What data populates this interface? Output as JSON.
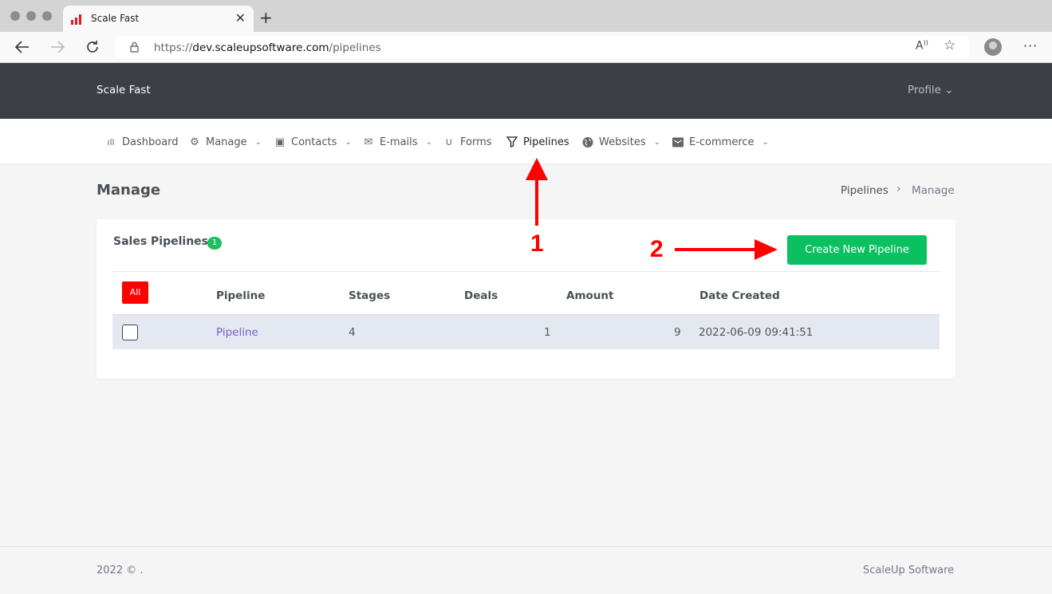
{
  "browser": {
    "tab_title": "Scale Fast",
    "tab_close": "✕",
    "new_tab": "+",
    "url_prefix": "https://",
    "url_host": "dev.scaleupsoftware.com",
    "url_path": "/pipelines",
    "brand_color": "#e8141d"
  },
  "header": {
    "brand": "Scale Fast",
    "profile_label": "Profile ⌄"
  },
  "nav": {
    "items": [
      {
        "label": "Dashboard",
        "icon": "bar-chart-icon",
        "glyph": "ıll"
      },
      {
        "label": "Manage",
        "icon": "gear-icon",
        "glyph": "⚙"
      },
      {
        "label": "Contacts",
        "icon": "contact-card-icon",
        "glyph": "▣"
      },
      {
        "label": "E-mails",
        "icon": "envelope-icon",
        "glyph": "✉"
      },
      {
        "label": "Forms",
        "icon": "magnet-icon",
        "glyph": "∪"
      },
      {
        "label": "Pipelines",
        "icon": "filter-icon",
        "glyph": "⏷"
      },
      {
        "label": "Websites",
        "icon": "globe-icon",
        "glyph": "●"
      },
      {
        "label": "E-commerce",
        "icon": "store-icon",
        "glyph": "▬"
      }
    ],
    "chevron": "⌄"
  },
  "page": {
    "title": "Manage",
    "breadcrumb": {
      "root": "Pipelines",
      "separator": "›",
      "current": "Manage"
    }
  },
  "card": {
    "title": "Sales Pipelines",
    "count": "1",
    "create_button": "Create New Pipeline",
    "all_button": "All",
    "columns": [
      "Pipeline",
      "Stages",
      "Deals",
      "Amount",
      "Date Created"
    ],
    "rows": [
      {
        "pipeline": "Pipeline",
        "stages": "4",
        "deals": "1",
        "amount": "9",
        "date_created": "2022-06-09 09:41:51"
      }
    ]
  },
  "annotations": {
    "one": "1",
    "two": "2",
    "color": "#ff0000"
  },
  "footer": {
    "left": "2022 © .",
    "right": "ScaleUp Software"
  }
}
